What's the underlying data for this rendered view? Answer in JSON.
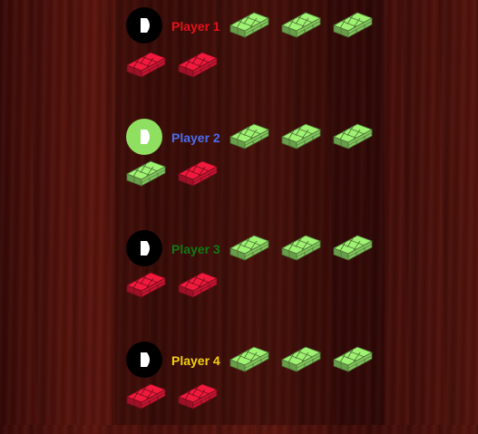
{
  "colors": {
    "brick_green": "#94e06a",
    "brick_red": "#e01838",
    "active_button": "#8fe060",
    "inactive_button": "#000000"
  },
  "players": [
    {
      "label": "Player 1",
      "label_color": "#e8101a",
      "active": false,
      "top_bricks": [
        "green",
        "green",
        "green"
      ],
      "bottom_bricks": [
        "red",
        "red"
      ]
    },
    {
      "label": "Player 2",
      "label_color": "#4a6cf0",
      "active": true,
      "top_bricks": [
        "green",
        "green",
        "green"
      ],
      "bottom_bricks": [
        "green",
        "red"
      ]
    },
    {
      "label": "Player 3",
      "label_color": "#0f7a12",
      "active": false,
      "top_bricks": [
        "green",
        "green",
        "green"
      ],
      "bottom_bricks": [
        "red",
        "red"
      ]
    },
    {
      "label": "Player 4",
      "label_color": "#f3d10f",
      "active": false,
      "top_bricks": [
        "green",
        "green",
        "green"
      ],
      "bottom_bricks": [
        "red",
        "red"
      ]
    }
  ]
}
